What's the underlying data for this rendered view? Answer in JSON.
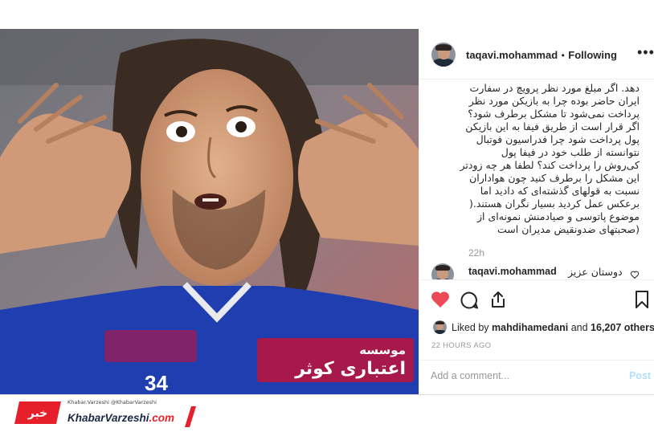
{
  "header": {
    "username": "taqavi.mohammad",
    "separator": "•",
    "follow_status": "Following",
    "more_icon": "more-horizontal-icon"
  },
  "caption": {
    "lines": [
      "دهد. اگر مبلغ مورد نظر پرویچ در سفارت",
      "ایران حاضر بوده چرا به بازیکن مورد نظر",
      "پرداخت نمی‌شود تا مشکل برطرف شود؟",
      "اگر قرار است از طریق فیفا به این بازیکن",
      "پول پرداخت شود چرا فدراسیون فوتبال",
      "نتوانسته از طلب خود در فیفا پول",
      "کی‌روش را پرداخت کند؟ لطفا هر چه زودتر",
      "این مشکل را برطرف کنید چون هواداران",
      "نسبت به قولهای گذشته‌ای که دادید اما",
      "برعکس عمل کردید بسیار نگران هستند.(",
      "موضوع پاتوسی و صیادمنش نمونه‌ای از",
      "(صحبتهای ضدونقیض مدیران است"
    ],
    "age": "22h"
  },
  "comment": {
    "username": "taqavi.mohammad",
    "text": "دوستان عزیز"
  },
  "actions": {
    "like_icon": "heart-filled-icon",
    "comment_icon": "comment-icon",
    "share_icon": "share-icon",
    "save_icon": "bookmark-icon",
    "liked_by_prefix": "Liked by",
    "liked_by_user": "mahdihamedani",
    "liked_by_and": "and",
    "liked_by_count": "16,207 others",
    "timestamp": "22 HOURS AGO",
    "like_color": "#ed4956"
  },
  "comment_box": {
    "placeholder": "Add a comment...",
    "post_label": "Post"
  },
  "footer": {
    "badge_text": "خبر",
    "brand_main": "KhabarVarzeshi",
    "brand_suffix": ".com",
    "social_handles": "Khabar.Varzeshi  @KhabarVarzeshi",
    "brand_color": "#e5202a"
  },
  "photo": {
    "jersey_text_top": "موسسه",
    "jersey_text_main": "اعتباری کوثر",
    "jersey_number": "34"
  }
}
